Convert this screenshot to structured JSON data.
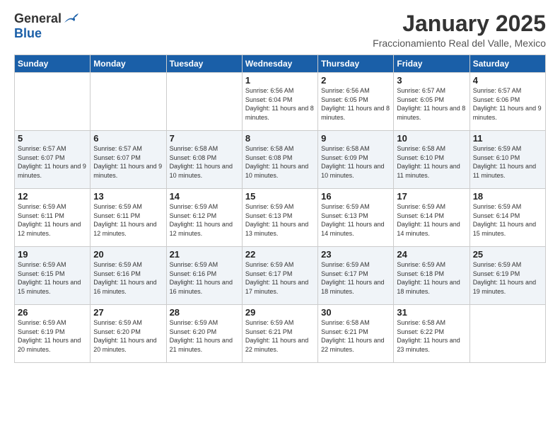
{
  "logo": {
    "general": "General",
    "blue": "Blue"
  },
  "title": "January 2025",
  "subtitle": "Fraccionamiento Real del Valle, Mexico",
  "days_of_week": [
    "Sunday",
    "Monday",
    "Tuesday",
    "Wednesday",
    "Thursday",
    "Friday",
    "Saturday"
  ],
  "weeks": [
    [
      {
        "num": "",
        "sunrise": "",
        "sunset": "",
        "daylight": ""
      },
      {
        "num": "",
        "sunrise": "",
        "sunset": "",
        "daylight": ""
      },
      {
        "num": "",
        "sunrise": "",
        "sunset": "",
        "daylight": ""
      },
      {
        "num": "1",
        "sunrise": "Sunrise: 6:56 AM",
        "sunset": "Sunset: 6:04 PM",
        "daylight": "Daylight: 11 hours and 8 minutes."
      },
      {
        "num": "2",
        "sunrise": "Sunrise: 6:56 AM",
        "sunset": "Sunset: 6:05 PM",
        "daylight": "Daylight: 11 hours and 8 minutes."
      },
      {
        "num": "3",
        "sunrise": "Sunrise: 6:57 AM",
        "sunset": "Sunset: 6:05 PM",
        "daylight": "Daylight: 11 hours and 8 minutes."
      },
      {
        "num": "4",
        "sunrise": "Sunrise: 6:57 AM",
        "sunset": "Sunset: 6:06 PM",
        "daylight": "Daylight: 11 hours and 9 minutes."
      }
    ],
    [
      {
        "num": "5",
        "sunrise": "Sunrise: 6:57 AM",
        "sunset": "Sunset: 6:07 PM",
        "daylight": "Daylight: 11 hours and 9 minutes."
      },
      {
        "num": "6",
        "sunrise": "Sunrise: 6:57 AM",
        "sunset": "Sunset: 6:07 PM",
        "daylight": "Daylight: 11 hours and 9 minutes."
      },
      {
        "num": "7",
        "sunrise": "Sunrise: 6:58 AM",
        "sunset": "Sunset: 6:08 PM",
        "daylight": "Daylight: 11 hours and 10 minutes."
      },
      {
        "num": "8",
        "sunrise": "Sunrise: 6:58 AM",
        "sunset": "Sunset: 6:08 PM",
        "daylight": "Daylight: 11 hours and 10 minutes."
      },
      {
        "num": "9",
        "sunrise": "Sunrise: 6:58 AM",
        "sunset": "Sunset: 6:09 PM",
        "daylight": "Daylight: 11 hours and 10 minutes."
      },
      {
        "num": "10",
        "sunrise": "Sunrise: 6:58 AM",
        "sunset": "Sunset: 6:10 PM",
        "daylight": "Daylight: 11 hours and 11 minutes."
      },
      {
        "num": "11",
        "sunrise": "Sunrise: 6:59 AM",
        "sunset": "Sunset: 6:10 PM",
        "daylight": "Daylight: 11 hours and 11 minutes."
      }
    ],
    [
      {
        "num": "12",
        "sunrise": "Sunrise: 6:59 AM",
        "sunset": "Sunset: 6:11 PM",
        "daylight": "Daylight: 11 hours and 12 minutes."
      },
      {
        "num": "13",
        "sunrise": "Sunrise: 6:59 AM",
        "sunset": "Sunset: 6:11 PM",
        "daylight": "Daylight: 11 hours and 12 minutes."
      },
      {
        "num": "14",
        "sunrise": "Sunrise: 6:59 AM",
        "sunset": "Sunset: 6:12 PM",
        "daylight": "Daylight: 11 hours and 12 minutes."
      },
      {
        "num": "15",
        "sunrise": "Sunrise: 6:59 AM",
        "sunset": "Sunset: 6:13 PM",
        "daylight": "Daylight: 11 hours and 13 minutes."
      },
      {
        "num": "16",
        "sunrise": "Sunrise: 6:59 AM",
        "sunset": "Sunset: 6:13 PM",
        "daylight": "Daylight: 11 hours and 14 minutes."
      },
      {
        "num": "17",
        "sunrise": "Sunrise: 6:59 AM",
        "sunset": "Sunset: 6:14 PM",
        "daylight": "Daylight: 11 hours and 14 minutes."
      },
      {
        "num": "18",
        "sunrise": "Sunrise: 6:59 AM",
        "sunset": "Sunset: 6:14 PM",
        "daylight": "Daylight: 11 hours and 15 minutes."
      }
    ],
    [
      {
        "num": "19",
        "sunrise": "Sunrise: 6:59 AM",
        "sunset": "Sunset: 6:15 PM",
        "daylight": "Daylight: 11 hours and 15 minutes."
      },
      {
        "num": "20",
        "sunrise": "Sunrise: 6:59 AM",
        "sunset": "Sunset: 6:16 PM",
        "daylight": "Daylight: 11 hours and 16 minutes."
      },
      {
        "num": "21",
        "sunrise": "Sunrise: 6:59 AM",
        "sunset": "Sunset: 6:16 PM",
        "daylight": "Daylight: 11 hours and 16 minutes."
      },
      {
        "num": "22",
        "sunrise": "Sunrise: 6:59 AM",
        "sunset": "Sunset: 6:17 PM",
        "daylight": "Daylight: 11 hours and 17 minutes."
      },
      {
        "num": "23",
        "sunrise": "Sunrise: 6:59 AM",
        "sunset": "Sunset: 6:17 PM",
        "daylight": "Daylight: 11 hours and 18 minutes."
      },
      {
        "num": "24",
        "sunrise": "Sunrise: 6:59 AM",
        "sunset": "Sunset: 6:18 PM",
        "daylight": "Daylight: 11 hours and 18 minutes."
      },
      {
        "num": "25",
        "sunrise": "Sunrise: 6:59 AM",
        "sunset": "Sunset: 6:19 PM",
        "daylight": "Daylight: 11 hours and 19 minutes."
      }
    ],
    [
      {
        "num": "26",
        "sunrise": "Sunrise: 6:59 AM",
        "sunset": "Sunset: 6:19 PM",
        "daylight": "Daylight: 11 hours and 20 minutes."
      },
      {
        "num": "27",
        "sunrise": "Sunrise: 6:59 AM",
        "sunset": "Sunset: 6:20 PM",
        "daylight": "Daylight: 11 hours and 20 minutes."
      },
      {
        "num": "28",
        "sunrise": "Sunrise: 6:59 AM",
        "sunset": "Sunset: 6:20 PM",
        "daylight": "Daylight: 11 hours and 21 minutes."
      },
      {
        "num": "29",
        "sunrise": "Sunrise: 6:59 AM",
        "sunset": "Sunset: 6:21 PM",
        "daylight": "Daylight: 11 hours and 22 minutes."
      },
      {
        "num": "30",
        "sunrise": "Sunrise: 6:58 AM",
        "sunset": "Sunset: 6:21 PM",
        "daylight": "Daylight: 11 hours and 22 minutes."
      },
      {
        "num": "31",
        "sunrise": "Sunrise: 6:58 AM",
        "sunset": "Sunset: 6:22 PM",
        "daylight": "Daylight: 11 hours and 23 minutes."
      },
      {
        "num": "",
        "sunrise": "",
        "sunset": "",
        "daylight": ""
      }
    ]
  ]
}
